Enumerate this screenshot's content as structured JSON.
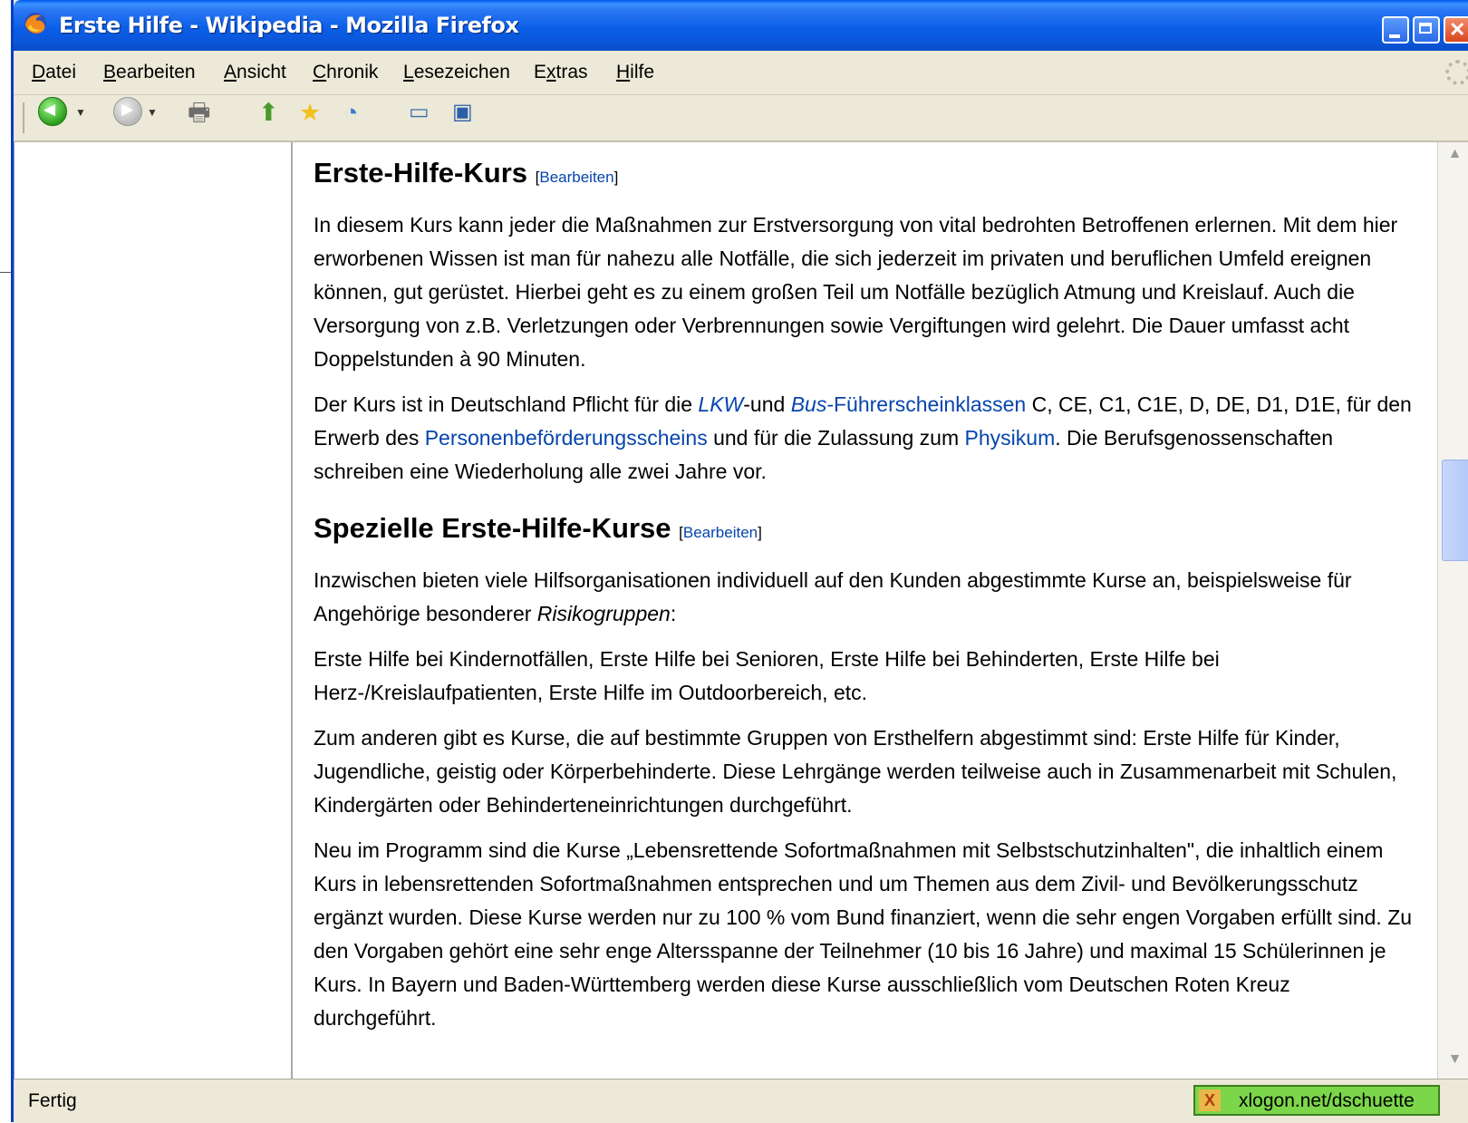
{
  "window": {
    "title": "Erste Hilfe - Wikipedia - Mozilla Firefox"
  },
  "menubar": {
    "items": [
      {
        "pre": "",
        "u": "D",
        "post": "atei"
      },
      {
        "pre": "",
        "u": "B",
        "post": "earbeiten"
      },
      {
        "pre": "",
        "u": "A",
        "post": "nsicht"
      },
      {
        "pre": "",
        "u": "C",
        "post": "hronik"
      },
      {
        "pre": "",
        "u": "L",
        "post": "esezeichen"
      },
      {
        "pre": "E",
        "u": "x",
        "post": "tras"
      },
      {
        "pre": "",
        "u": "H",
        "post": "ilfe"
      }
    ]
  },
  "toolbar": {
    "icons": [
      "back-icon",
      "forward-icon",
      "print-icon",
      "downloads-icon",
      "bookmark-star-icon",
      "history-icon",
      "new-window-icon",
      "new-tab-icon"
    ]
  },
  "article": {
    "section1": {
      "heading": "Erste-Hilfe-Kurs",
      "edit_label": "Bearbeiten",
      "p1": "In diesem Kurs kann jeder die Maßnahmen zur Erstversorgung von vital bedrohten Betroffenen erlernen. Mit dem hier erworbenen Wissen ist man für nahezu alle Notfälle, die sich jederzeit im privaten und beruflichen Umfeld ereignen können, gut gerüstet. Hierbei geht es zu einem großen Teil um Notfälle bezüglich Atmung und Kreislauf. Auch die Versorgung von z.B. Verletzungen oder Verbrennungen sowie Vergiftungen wird gelehrt. Die Dauer umfasst acht Doppelstunden à 90 Minuten.",
      "p2": {
        "t1": "Der Kurs ist in Deutschland Pflicht für die ",
        "link_lkw": "LKW",
        "t2": "-und ",
        "link_bus": "Bus",
        "link_fuehrerschein": "-Führerscheinklassen",
        "t3": " C, CE, C1, C1E, D, DE, D1, D1E, für den Erwerb des ",
        "link_personen": "Personenbeförderungsscheins",
        "t4": " und für die Zulassung zum ",
        "link_physikum": "Physikum",
        "t5": ". Die Berufsgenossenschaften schreiben eine Wiederholung alle zwei Jahre vor."
      }
    },
    "section2": {
      "heading": "Spezielle Erste-Hilfe-Kurse",
      "edit_label": "Bearbeiten",
      "p1_a": "Inzwischen bieten viele Hilfsorganisationen individuell auf den Kunden abgestimmte Kurse an, beispielsweise für Angehörige besonderer ",
      "p1_em": "Risikogruppen",
      "p1_b": ":",
      "p2": "Erste Hilfe bei Kindernotfällen, Erste Hilfe bei Senioren, Erste Hilfe bei Behinderten, Erste Hilfe bei Herz-/Kreislaufpatienten, Erste Hilfe im Outdoorbereich, etc.",
      "p3": "Zum anderen gibt es Kurse, die auf bestimmte Gruppen von Ersthelfern abgestimmt sind: Erste Hilfe für Kinder, Jugendliche, geistig oder Körperbehinderte. Diese Lehrgänge werden teilweise auch in Zusammenarbeit mit Schulen, Kindergärten oder Behinderteneinrichtungen durchgeführt.",
      "p4": "Neu im Programm sind die Kurse „Lebensrettende Sofortmaßnahmen mit Selbstschutzinhalten\", die inhaltlich einem Kurs in lebensrettenden Sofortmaßnahmen entsprechen und um Themen aus dem Zivil- und Bevölkerungsschutz ergänzt wurden. Diese Kurse werden nur zu 100 % vom Bund finanziert, wenn die sehr engen Vorgaben erfüllt sind. Zu den Vorgaben gehört eine sehr enge Altersspanne der Teilnehmer (10 bis 16 Jahre) und maximal 15 Schülerinnen je Kurs. In Bayern und Baden-Württemberg werden diese Kurse ausschließlich vom Deutschen Roten Kreuz durchgeführt."
    }
  },
  "statusbar": {
    "text": "Fertig",
    "badge": "xlogon.net/dschuette"
  },
  "colors": {
    "link": "#0645ad",
    "titlebar": "#0a5fe8",
    "status_badge": "#7cd64a"
  }
}
